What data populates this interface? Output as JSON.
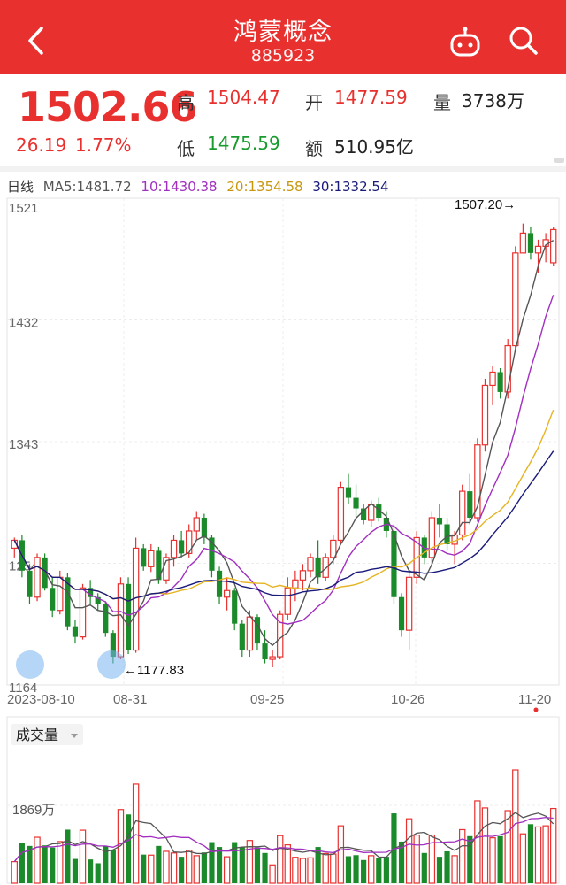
{
  "header": {
    "title": "鸿蒙概念",
    "code": "885923",
    "bg_color": "#e8312f",
    "back_icon": "chevron-left-icon",
    "robot_icon": "robot-icon",
    "search_icon": "search-icon"
  },
  "quote": {
    "price": "1502.66",
    "change": "26.19",
    "change_pct": "1.77%",
    "high_label": "高",
    "high": "1504.47",
    "open_label": "开",
    "open": "1477.59",
    "volume_label": "量",
    "volume": "3738万",
    "low_label": "低",
    "low": "1475.59",
    "amount_label": "额",
    "amount": "510.95亿"
  },
  "ma_legend": {
    "period": "日线",
    "ma5": "MA5:1481.72",
    "ma10": "10:1430.38",
    "ma20": "20:1354.58",
    "ma30": "30:1332.54",
    "colors": {
      "ma5": "#555555",
      "ma10": "#a12fbf",
      "ma20": "#e6b422",
      "ma30": "#1a1a7a"
    }
  },
  "chart_data": {
    "type": "candlestick",
    "y_ticks": [
      "1521",
      "1432",
      "1343",
      "1254",
      "1164"
    ],
    "x_labels": [
      "2023-08-10",
      "08-31",
      "09-25",
      "10-26",
      "11-20"
    ],
    "y_range": [
      1164,
      1521
    ],
    "max_annotation": "1507.20→",
    "min_annotation": "←1177.83",
    "up_color": "#e8312f",
    "down_color": "#1a8a2a",
    "ohlc": [
      [
        1262,
        1270,
        1255,
        1268
      ],
      [
        1268,
        1272,
        1240,
        1245
      ],
      [
        1245,
        1250,
        1220,
        1225
      ],
      [
        1225,
        1258,
        1222,
        1255
      ],
      [
        1255,
        1258,
        1230,
        1232
      ],
      [
        1232,
        1240,
        1210,
        1215
      ],
      [
        1215,
        1245,
        1212,
        1240
      ],
      [
        1240,
        1243,
        1200,
        1203
      ],
      [
        1203,
        1208,
        1190,
        1195
      ],
      [
        1195,
        1235,
        1193,
        1232
      ],
      [
        1232,
        1238,
        1220,
        1225
      ],
      [
        1225,
        1228,
        1215,
        1220
      ],
      [
        1220,
        1222,
        1195,
        1198
      ],
      [
        1198,
        1200,
        1175,
        1180
      ],
      [
        1180,
        1240,
        1178,
        1235
      ],
      [
        1235,
        1240,
        1182,
        1185
      ],
      [
        1185,
        1270,
        1183,
        1262
      ],
      [
        1262,
        1265,
        1245,
        1248
      ],
      [
        1248,
        1265,
        1244,
        1260
      ],
      [
        1260,
        1263,
        1235,
        1238
      ],
      [
        1238,
        1258,
        1235,
        1255
      ],
      [
        1255,
        1272,
        1248,
        1268
      ],
      [
        1268,
        1275,
        1255,
        1258
      ],
      [
        1258,
        1280,
        1255,
        1275
      ],
      [
        1275,
        1290,
        1268,
        1285
      ],
      [
        1285,
        1288,
        1265,
        1270
      ],
      [
        1270,
        1272,
        1240,
        1245
      ],
      [
        1245,
        1248,
        1220,
        1225
      ],
      [
        1225,
        1240,
        1215,
        1230
      ],
      [
        1230,
        1232,
        1200,
        1205
      ],
      [
        1205,
        1208,
        1180,
        1185
      ],
      [
        1185,
        1215,
        1180,
        1210
      ],
      [
        1210,
        1212,
        1185,
        1190
      ],
      [
        1190,
        1200,
        1175,
        1178
      ],
      [
        1178,
        1185,
        1172,
        1180
      ],
      [
        1180,
        1215,
        1178,
        1212
      ],
      [
        1212,
        1240,
        1208,
        1232
      ],
      [
        1232,
        1245,
        1222,
        1238
      ],
      [
        1238,
        1250,
        1230,
        1245
      ],
      [
        1245,
        1258,
        1240,
        1255
      ],
      [
        1255,
        1268,
        1235,
        1240
      ],
      [
        1240,
        1258,
        1237,
        1255
      ],
      [
        1255,
        1272,
        1250,
        1268
      ],
      [
        1268,
        1312,
        1265,
        1308
      ],
      [
        1308,
        1318,
        1295,
        1300
      ],
      [
        1300,
        1310,
        1285,
        1292
      ],
      [
        1292,
        1295,
        1280,
        1283
      ],
      [
        1283,
        1298,
        1278,
        1295
      ],
      [
        1295,
        1300,
        1282,
        1285
      ],
      [
        1285,
        1290,
        1270,
        1275
      ],
      [
        1275,
        1280,
        1220,
        1225
      ],
      [
        1225,
        1228,
        1195,
        1200
      ],
      [
        1200,
        1245,
        1185,
        1240
      ],
      [
        1240,
        1275,
        1235,
        1270
      ],
      [
        1270,
        1272,
        1250,
        1255
      ],
      [
        1255,
        1290,
        1250,
        1285
      ],
      [
        1285,
        1295,
        1270,
        1280
      ],
      [
        1280,
        1285,
        1260,
        1265
      ],
      [
        1265,
        1275,
        1250,
        1272
      ],
      [
        1272,
        1310,
        1268,
        1305
      ],
      [
        1305,
        1318,
        1280,
        1285
      ],
      [
        1285,
        1345,
        1282,
        1340
      ],
      [
        1340,
        1390,
        1335,
        1385
      ],
      [
        1385,
        1400,
        1370,
        1395
      ],
      [
        1395,
        1398,
        1375,
        1380
      ],
      [
        1380,
        1420,
        1375,
        1415
      ],
      [
        1415,
        1490,
        1410,
        1485
      ],
      [
        1485,
        1507.2,
        1495,
        1500
      ],
      [
        1500,
        1505,
        1480,
        1485
      ],
      [
        1485,
        1495,
        1470,
        1490
      ],
      [
        1490,
        1500,
        1478,
        1495
      ],
      [
        1477.59,
        1504.47,
        1475.59,
        1502.66
      ]
    ]
  },
  "volume": {
    "label": "成交量",
    "value_tick": "1869万"
  }
}
